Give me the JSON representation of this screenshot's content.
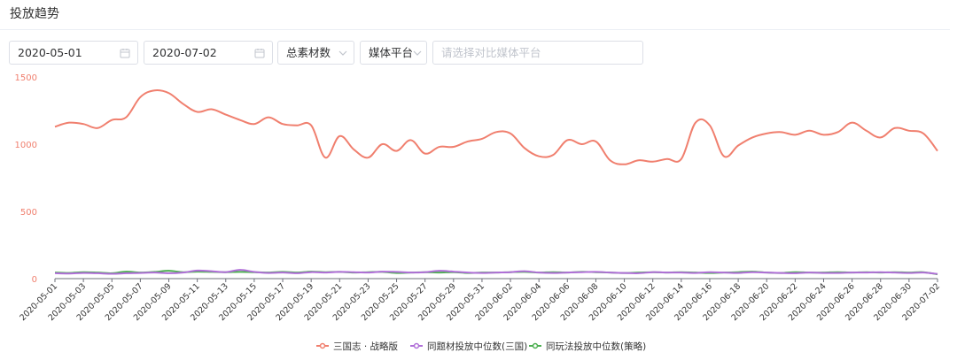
{
  "page": {
    "title": "投放趋势"
  },
  "filters": {
    "start_date": "2020-05-01",
    "end_date": "2020-07-02",
    "metric_select": "总素材数",
    "platform_select": "媒体平台",
    "compare_placeholder": "请选择对比媒体平台"
  },
  "icons": {
    "date": "calendar-icon",
    "select": "chevron-down-icon"
  },
  "colors": {
    "series1": "#f07f6e",
    "series2": "#b06fd8",
    "series3": "#4caf50",
    "axis_label": "#f07f6e"
  },
  "chart_data": {
    "type": "line",
    "title": "",
    "xlabel": "",
    "ylabel": "",
    "ylim": [
      0,
      1500
    ],
    "yticks": [
      0,
      500,
      1000,
      1500
    ],
    "grid": false,
    "legend": "bottom-center",
    "x": [
      "2020-05-01",
      "2020-05-02",
      "2020-05-03",
      "2020-05-04",
      "2020-05-05",
      "2020-05-06",
      "2020-05-07",
      "2020-05-08",
      "2020-05-09",
      "2020-05-10",
      "2020-05-11",
      "2020-05-12",
      "2020-05-13",
      "2020-05-14",
      "2020-05-15",
      "2020-05-16",
      "2020-05-17",
      "2020-05-18",
      "2020-05-19",
      "2020-05-20",
      "2020-05-21",
      "2020-05-22",
      "2020-05-23",
      "2020-05-24",
      "2020-05-25",
      "2020-05-26",
      "2020-05-27",
      "2020-05-28",
      "2020-05-29",
      "2020-05-30",
      "2020-05-31",
      "2020-06-01",
      "2020-06-02",
      "2020-06-03",
      "2020-06-04",
      "2020-06-05",
      "2020-06-06",
      "2020-06-07",
      "2020-06-08",
      "2020-06-09",
      "2020-06-10",
      "2020-06-11",
      "2020-06-12",
      "2020-06-13",
      "2020-06-14",
      "2020-06-15",
      "2020-06-16",
      "2020-06-17",
      "2020-06-18",
      "2020-06-19",
      "2020-06-20",
      "2020-06-21",
      "2020-06-22",
      "2020-06-23",
      "2020-06-24",
      "2020-06-25",
      "2020-06-26",
      "2020-06-27",
      "2020-06-28",
      "2020-06-29",
      "2020-06-30",
      "2020-07-01",
      "2020-07-02"
    ],
    "xtick_labels": [
      "2020-05-01",
      "2020-05-03",
      "2020-05-05",
      "2020-05-07",
      "2020-05-09",
      "2020-05-11",
      "2020-05-13",
      "2020-05-15",
      "2020-05-17",
      "2020-05-19",
      "2020-05-21",
      "2020-05-23",
      "2020-05-25",
      "2020-05-27",
      "2020-05-29",
      "2020-05-31",
      "2020-06-02",
      "2020-06-04",
      "2020-06-06",
      "2020-06-08",
      "2020-06-10",
      "2020-06-12",
      "2020-06-14",
      "2020-06-16",
      "2020-06-18",
      "2020-06-20",
      "2020-06-22",
      "2020-06-24",
      "2020-06-26",
      "2020-06-28",
      "2020-06-30",
      "2020-07-02"
    ],
    "series": [
      {
        "name": "三国志 · 战略版",
        "values": [
          1130,
          1160,
          1150,
          1120,
          1180,
          1200,
          1350,
          1400,
          1380,
          1300,
          1240,
          1260,
          1220,
          1180,
          1150,
          1200,
          1150,
          1140,
          1140,
          900,
          1060,
          960,
          900,
          1000,
          950,
          1030,
          930,
          980,
          980,
          1020,
          1040,
          1090,
          1080,
          970,
          910,
          920,
          1030,
          1000,
          1020,
          880,
          850,
          880,
          870,
          890,
          890,
          1160,
          1140,
          910,
          990,
          1050,
          1080,
          1090,
          1070,
          1100,
          1070,
          1090,
          1160,
          1100,
          1050,
          1120,
          1100,
          1080,
          950
        ]
      },
      {
        "name": "同题材投放中位数(三国)",
        "values": [
          40,
          38,
          42,
          40,
          36,
          40,
          42,
          45,
          40,
          45,
          60,
          55,
          48,
          65,
          50,
          42,
          45,
          40,
          48,
          45,
          50,
          48,
          45,
          52,
          50,
          45,
          48,
          58,
          52,
          45,
          42,
          45,
          48,
          55,
          45,
          42,
          45,
          48,
          50,
          45,
          42,
          40,
          48,
          45,
          45,
          42,
          48,
          45,
          42,
          48,
          45,
          42,
          40,
          45,
          42,
          42,
          45,
          45,
          48,
          45,
          42,
          45,
          35
        ]
      },
      {
        "name": "同玩法投放中位数(策略)",
        "values": [
          45,
          42,
          48,
          45,
          40,
          52,
          45,
          50,
          58,
          48,
          52,
          50,
          48,
          50,
          48,
          45,
          50,
          45,
          52,
          48,
          50,
          45,
          48,
          50,
          42,
          45,
          48,
          45,
          48,
          42,
          45,
          45,
          48,
          50,
          45,
          48,
          45,
          50,
          48,
          45,
          42,
          45,
          48,
          45,
          48,
          45,
          42,
          45,
          48,
          52,
          45,
          42,
          48,
          45,
          45,
          48,
          45,
          48,
          45,
          48,
          45,
          48,
          32
        ]
      }
    ]
  }
}
